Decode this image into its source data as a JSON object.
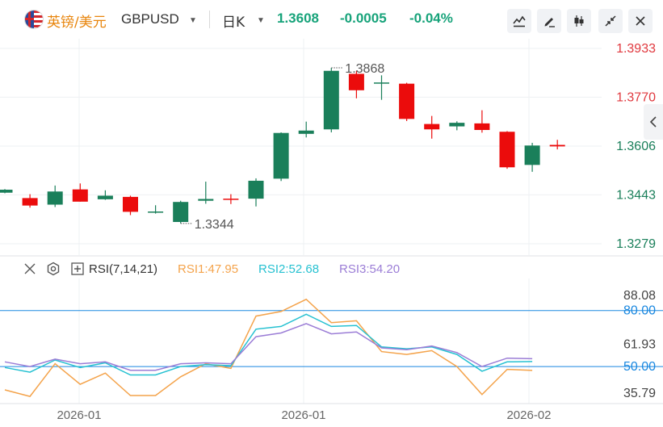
{
  "header": {
    "symbol_cn": "英镑/美元",
    "symbol_en": "GBPUSD",
    "period": "日K",
    "price": "1.3608",
    "change": "-0.0005",
    "change_pct": "-0.04%",
    "quote_color": "#17a37a",
    "icons": [
      "line-chart-icon",
      "draw-pen-icon",
      "candlestick-icon",
      "collapse-icon",
      "close-icon"
    ]
  },
  "colors": {
    "up": "#1a7f5a",
    "down": "#eb0c0c",
    "grid": "#eef0f3",
    "axis_up": "#e0383e",
    "axis_down": "#1a7f5a",
    "rsi1": "#f4a34b",
    "rsi2": "#26c1d1",
    "rsi3": "#9b7dd6",
    "level": "#1a88e0"
  },
  "rsi_header": {
    "name": "RSI(7,14,21)",
    "rsi1": "RSI1:47.95",
    "rsi2": "RSI2:52.68",
    "rsi3": "RSI3:54.20"
  },
  "chart_data": [
    {
      "type": "candlestick",
      "price_ticks": [
        "1.3933",
        "1.3770",
        "1.3606",
        "1.3443",
        "1.3279"
      ],
      "max_label": "1.3868",
      "min_label": "1.3344",
      "candles": [
        {
          "o": 1.345,
          "c": 1.346,
          "h": 1.3462,
          "l": 1.3448
        },
        {
          "o": 1.3432,
          "c": 1.3407,
          "h": 1.3445,
          "l": 1.34
        },
        {
          "o": 1.341,
          "c": 1.3454,
          "h": 1.3474,
          "l": 1.3402
        },
        {
          "o": 1.3461,
          "c": 1.342,
          "h": 1.3481,
          "l": 1.342
        },
        {
          "o": 1.3428,
          "c": 1.344,
          "h": 1.3458,
          "l": 1.3426
        },
        {
          "o": 1.3436,
          "c": 1.3386,
          "h": 1.344,
          "l": 1.3375
        },
        {
          "o": 1.3385,
          "c": 1.3387,
          "h": 1.3408,
          "l": 1.338
        },
        {
          "o": 1.3352,
          "c": 1.3419,
          "h": 1.3423,
          "l": 1.3347
        },
        {
          "o": 1.3423,
          "c": 1.3429,
          "h": 1.3487,
          "l": 1.3413
        },
        {
          "o": 1.343,
          "c": 1.3427,
          "h": 1.3445,
          "l": 1.3412
        },
        {
          "o": 1.343,
          "c": 1.349,
          "h": 1.3498,
          "l": 1.3404
        },
        {
          "o": 1.3497,
          "c": 1.365,
          "h": 1.3652,
          "l": 1.3489
        },
        {
          "o": 1.3647,
          "c": 1.3658,
          "h": 1.3688,
          "l": 1.3635
        },
        {
          "o": 1.3662,
          "c": 1.3858,
          "h": 1.3868,
          "l": 1.3652
        },
        {
          "o": 1.3848,
          "c": 1.3793,
          "h": 1.3858,
          "l": 1.3766
        },
        {
          "o": 1.3817,
          "c": 1.3819,
          "h": 1.3843,
          "l": 1.3761
        },
        {
          "o": 1.3815,
          "c": 1.3697,
          "h": 1.3818,
          "l": 1.369
        },
        {
          "o": 1.368,
          "c": 1.3662,
          "h": 1.3707,
          "l": 1.3631
        },
        {
          "o": 1.3672,
          "c": 1.3684,
          "h": 1.3689,
          "l": 1.3659
        },
        {
          "o": 1.3682,
          "c": 1.366,
          "h": 1.3726,
          "l": 1.3651
        },
        {
          "o": 1.3654,
          "c": 1.3535,
          "h": 1.3656,
          "l": 1.353
        },
        {
          "o": 1.3543,
          "c": 1.3608,
          "h": 1.3617,
          "l": 1.352
        },
        {
          "o": 1.361,
          "c": 1.3605,
          "h": 1.3627,
          "l": 1.3595
        }
      ]
    },
    {
      "type": "line",
      "title": "RSI(7,14,21)",
      "y_ticks": [
        "88.08",
        "80.00",
        "61.93",
        "50.00",
        "35.79"
      ],
      "levels": [
        80,
        50
      ],
      "x_labels": [
        "2026-01",
        "2026-01",
        "2026-02"
      ],
      "series": [
        {
          "name": "RSI1",
          "values": [
            37.5,
            34.0,
            51.5,
            40.5,
            46.5,
            34.5,
            34.5,
            44.5,
            51.5,
            49.0,
            77.0,
            79.5,
            86.0,
            73.5,
            74.5,
            58.0,
            56.5,
            58.5,
            50.0,
            35.0,
            48.5,
            47.95
          ]
        },
        {
          "name": "RSI2",
          "values": [
            49.5,
            47.0,
            53.5,
            49.5,
            52.0,
            45.5,
            45.5,
            50.0,
            51.0,
            50.5,
            70.0,
            71.5,
            78.0,
            71.5,
            72.0,
            60.5,
            59.5,
            60.5,
            56.5,
            47.5,
            52.5,
            52.68
          ]
        },
        {
          "name": "RSI3",
          "values": [
            52.5,
            50.0,
            54.0,
            51.5,
            52.5,
            48.0,
            48.0,
            51.5,
            52.0,
            51.5,
            66.0,
            68.0,
            73.0,
            67.5,
            68.5,
            60.0,
            59.0,
            61.0,
            57.5,
            50.0,
            54.5,
            54.2
          ]
        }
      ]
    }
  ]
}
